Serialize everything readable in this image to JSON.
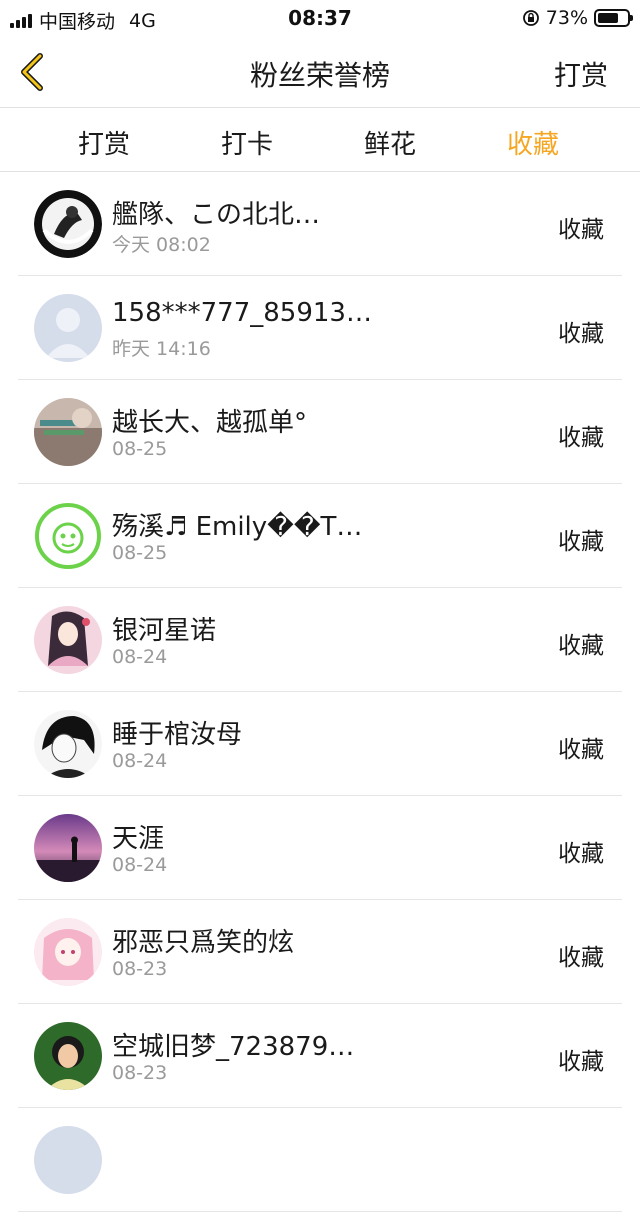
{
  "status_bar": {
    "carrier": "中国移动",
    "network": "4G",
    "time": "08:37",
    "battery": "73%",
    "battery_level": 0.73
  },
  "nav": {
    "title": "粉丝荣誉榜",
    "right_label": "打赏",
    "back_icon": "chevron-left-icon",
    "accent_color": "#f5a623"
  },
  "tabs": [
    {
      "label": "打赏",
      "active": false
    },
    {
      "label": "打卡",
      "active": false
    },
    {
      "label": "鲜花",
      "active": false
    },
    {
      "label": "收藏",
      "active": true
    }
  ],
  "list": [
    {
      "name": "艦隊、この北北…",
      "time": "今天 08:02",
      "action": "收藏"
    },
    {
      "name": "158***777_85913…",
      "time": "昨天 14:16",
      "action": "收藏"
    },
    {
      "name": "越长大、越孤单°",
      "time": "08-25",
      "action": "收藏"
    },
    {
      "name": "殇溪♬ Emily��T…",
      "time": "08-25",
      "action": "收藏"
    },
    {
      "name": "银河星诺",
      "time": "08-24",
      "action": "收藏"
    },
    {
      "name": "睡于棺汝母",
      "time": "08-24",
      "action": "收藏"
    },
    {
      "name": "天涯",
      "time": "08-24",
      "action": "收藏"
    },
    {
      "name": "邪恶只爲笑的炫",
      "time": "08-23",
      "action": "收藏"
    },
    {
      "name": "空城旧梦_723879…",
      "time": "08-23",
      "action": "收藏"
    },
    {
      "name": "",
      "time": "",
      "action": ""
    }
  ]
}
